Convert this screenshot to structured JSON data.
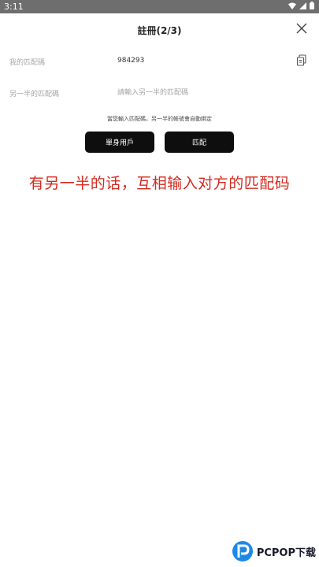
{
  "status_bar": {
    "time": "3:11"
  },
  "header": {
    "title": "註冊(2/3)"
  },
  "my_code": {
    "label": "我的匹配碼",
    "value": "984293"
  },
  "partner_code": {
    "label": "另一半的匹配碼",
    "placeholder": "請輸入另一半的匹配碼",
    "value": ""
  },
  "hint": "當您輸入匹配碼，另一半的帳號會自動綁定",
  "buttons": {
    "single": "單身用戶",
    "match": "匹配"
  },
  "annotation": "有另一半的话，互相输入对方的匹配码",
  "watermark": {
    "brand": "PCPOP下载"
  },
  "colors": {
    "annotation": "#d42a1e",
    "button_bg": "#0e0e0e",
    "status_bar": "#6e6e6e"
  }
}
